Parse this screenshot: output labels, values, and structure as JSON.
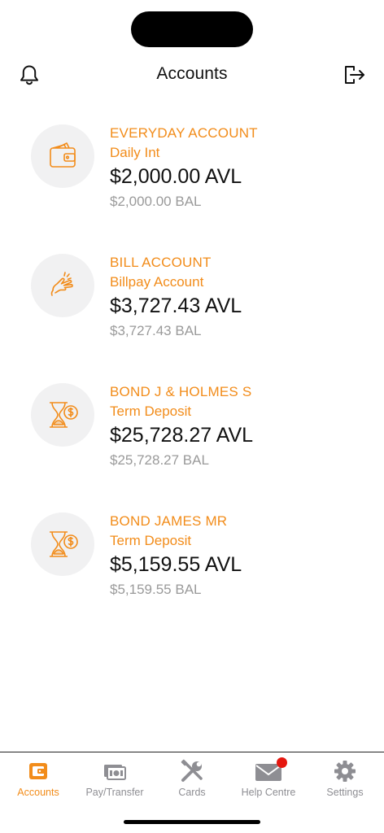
{
  "status": {},
  "header": {
    "title": "Accounts",
    "left_icon": "bell-icon",
    "right_icon": "logout-icon"
  },
  "accounts": [
    {
      "name": "EVERYDAY ACCOUNT",
      "type": "Daily Int",
      "available": "$2,000.00 AVL",
      "balance": "$2,000.00 BAL",
      "icon": "wallet-icon"
    },
    {
      "name": "BILL ACCOUNT",
      "type": "Billpay Account",
      "available": "$3,727.43 AVL",
      "balance": "$3,727.43 BAL",
      "icon": "snapping-fingers-icon"
    },
    {
      "name": "BOND J & HOLMES S",
      "type": "Term Deposit",
      "available": "$25,728.27 AVL",
      "balance": "$25,728.27 BAL",
      "icon": "hourglass-dollar-icon"
    },
    {
      "name": "BOND JAMES MR",
      "type": "Term Deposit",
      "available": "$5,159.55 AVL",
      "balance": "$5,159.55 BAL",
      "icon": "hourglass-dollar-icon"
    }
  ],
  "tabbar": {
    "items": [
      {
        "label": "Accounts",
        "icon": "wallet-icon",
        "active": true
      },
      {
        "label": "Pay/Transfer",
        "icon": "cash-icon",
        "active": false
      },
      {
        "label": "Cards",
        "icon": "tools-icon",
        "active": false
      },
      {
        "label": "Help Centre",
        "icon": "mail-icon",
        "active": false,
        "badge": true
      },
      {
        "label": "Settings",
        "icon": "gear-icon",
        "active": false
      }
    ]
  },
  "colors": {
    "accent": "#f28c1a",
    "muted": "#9a9a9a",
    "badge": "#e5170f",
    "avatar_bg": "#f1f1f2"
  }
}
